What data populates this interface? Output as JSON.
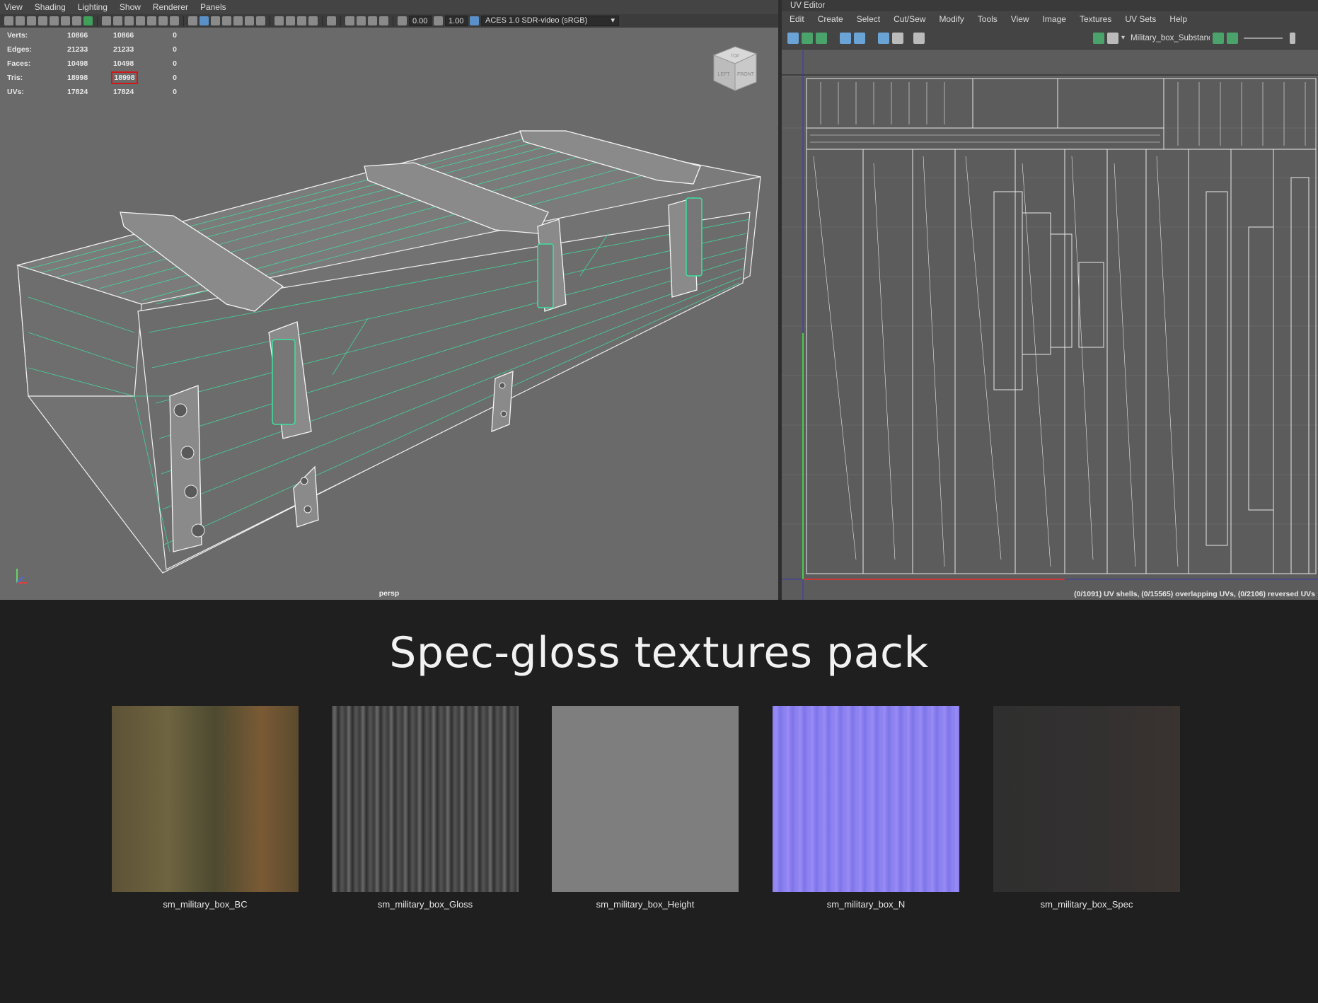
{
  "viewport": {
    "menu": [
      "View",
      "Shading",
      "Lighting",
      "Show",
      "Renderer",
      "Panels"
    ],
    "toolbar": {
      "exposure": "0.00",
      "gamma": "1.00",
      "color_space": "ACES 1.0 SDR-video (sRGB)"
    },
    "hud": [
      {
        "label": "Verts:",
        "v1": "10866",
        "v2": "10866",
        "v3": "0"
      },
      {
        "label": "Edges:",
        "v1": "21233",
        "v2": "21233",
        "v3": "0"
      },
      {
        "label": "Faces:",
        "v1": "10498",
        "v2": "10498",
        "v3": "0"
      },
      {
        "label": "Tris:",
        "v1": "18998",
        "v2": "18998",
        "v3": "0"
      },
      {
        "label": "UVs:",
        "v1": "17824",
        "v2": "17824",
        "v3": "0"
      }
    ],
    "camera_label": "persp",
    "viewcube": {
      "top": "TOP",
      "left": "LEFT",
      "front": "FRONT"
    },
    "highlight_color": "#d01818",
    "wire_color": "#3fe0a0"
  },
  "uv_editor": {
    "title": "UV Editor",
    "menu": [
      "Edit",
      "Create",
      "Select",
      "Cut/Sew",
      "Modify",
      "Tools",
      "View",
      "Image",
      "Textures",
      "UV Sets",
      "Help"
    ],
    "texture_name": "Military_box_Substance",
    "status": "(0/1091) UV shells, (0/15565) overlapping UVs, (0/2106) reversed UVs"
  },
  "pack": {
    "title": "Spec-gloss textures pack",
    "textures": [
      {
        "name": "sm_military_box_BC",
        "color": "#5d5236"
      },
      {
        "name": "sm_military_box_Gloss",
        "color": "#4a4a4a"
      },
      {
        "name": "sm_military_box_Height",
        "color": "#7e7e7e"
      },
      {
        "name": "sm_military_box_N",
        "color": "#8a7ef0"
      },
      {
        "name": "sm_military_box_Spec",
        "color": "#2f2f2f"
      }
    ]
  }
}
